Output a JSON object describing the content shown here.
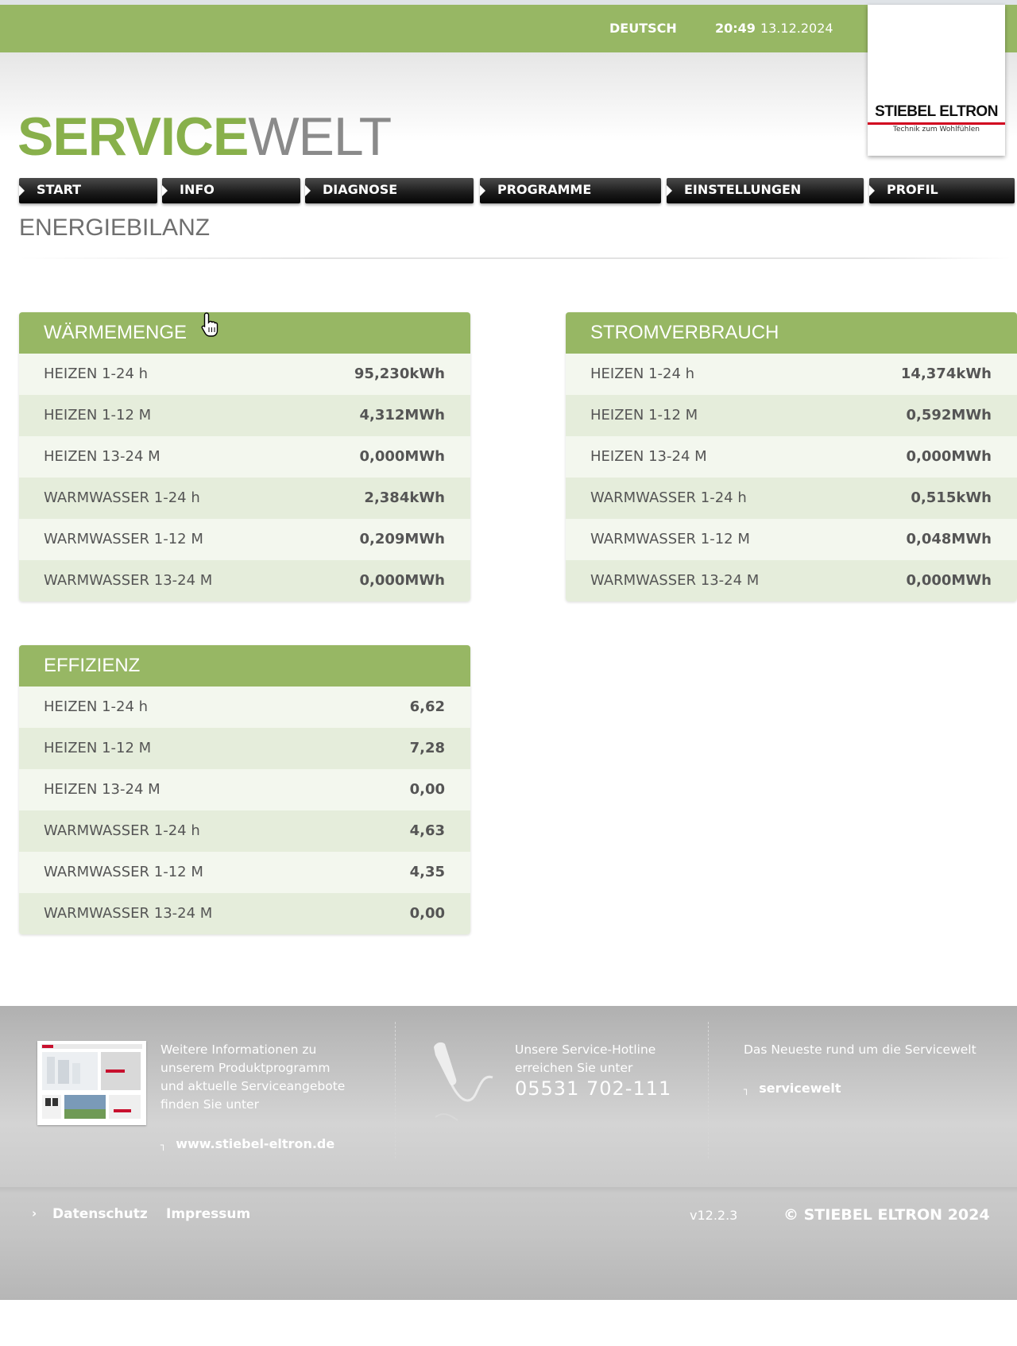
{
  "header": {
    "language": "DEUTSCH",
    "time": "20:49",
    "date": "13.12.2024",
    "brand_title_1": "SERVICE",
    "brand_title_2": "WELT",
    "logo_text": "STIEBEL ELTRON",
    "logo_tagline": "Technik zum Wohlfühlen"
  },
  "nav": {
    "items": [
      {
        "label": "START"
      },
      {
        "label": "INFO"
      },
      {
        "label": "DIAGNOSE"
      },
      {
        "label": "PROGRAMME"
      },
      {
        "label": "EINSTELLUNGEN"
      },
      {
        "label": "PROFIL"
      }
    ]
  },
  "page": {
    "title": "ENERGIEBILANZ"
  },
  "waermemenge": {
    "title": "WÄRMEMENGE",
    "rows": [
      {
        "label": "HEIZEN 1-24 h",
        "value": "95,230kWh"
      },
      {
        "label": "HEIZEN 1-12 M",
        "value": "4,312MWh"
      },
      {
        "label": "HEIZEN 13-24 M",
        "value": "0,000MWh"
      },
      {
        "label": "WARMWASSER 1-24 h",
        "value": "2,384kWh"
      },
      {
        "label": "WARMWASSER 1-12 M",
        "value": "0,209MWh"
      },
      {
        "label": "WARMWASSER 13-24 M",
        "value": "0,000MWh"
      }
    ]
  },
  "stromverbrauch": {
    "title": "STROMVERBRAUCH",
    "rows": [
      {
        "label": "HEIZEN 1-24 h",
        "value": "14,374kWh"
      },
      {
        "label": "HEIZEN 1-12 M",
        "value": "0,592MWh"
      },
      {
        "label": "HEIZEN 13-24 M",
        "value": "0,000MWh"
      },
      {
        "label": "WARMWASSER 1-24 h",
        "value": "0,515kWh"
      },
      {
        "label": "WARMWASSER 1-12 M",
        "value": "0,048MWh"
      },
      {
        "label": "WARMWASSER 13-24 M",
        "value": "0,000MWh"
      }
    ]
  },
  "effizienz": {
    "title": "EFFIZIENZ",
    "rows": [
      {
        "label": "HEIZEN 1-24 h",
        "value": "6,62"
      },
      {
        "label": "HEIZEN 1-12 M",
        "value": "7,28"
      },
      {
        "label": "HEIZEN 13-24 M",
        "value": "0,00"
      },
      {
        "label": "WARMWASSER 1-24 h",
        "value": "4,63"
      },
      {
        "label": "WARMWASSER 1-12 M",
        "value": "4,35"
      },
      {
        "label": "WARMWASSER 13-24 M",
        "value": "0,00"
      }
    ]
  },
  "footer": {
    "info_text": [
      "Weitere Informationen zu",
      "unserem Produktprogramm",
      "und aktuelle Serviceangebote",
      "finden Sie unter"
    ],
    "website_link": "www.stiebel-eltron.de",
    "hotline_text": [
      "Unsere Service-Hotline",
      "erreichen Sie unter"
    ],
    "hotline_number": "05531 702-111",
    "news_text": "Das Neueste rund um die Servicewelt",
    "news_link": "servicewelt",
    "privacy_link": "Datenschutz",
    "imprint_link": "Impressum",
    "version": "v12.2.3",
    "copyright": "© STIEBEL ELTRON 2024"
  },
  "colors": {
    "accent_green": "#97b764",
    "row_light": "#f3f7ee",
    "row_dark": "#e5eddb",
    "logo_red": "#d1001f"
  }
}
